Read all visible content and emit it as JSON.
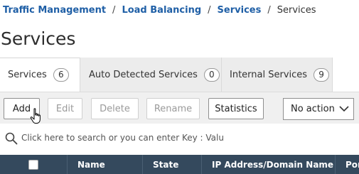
{
  "breadcrumb": {
    "items": [
      "Traffic Management",
      "Load Balancing",
      "Services"
    ],
    "current": "Services",
    "separator": "/"
  },
  "page": {
    "title": "Services"
  },
  "tabs": [
    {
      "label": "Services",
      "count": "6",
      "active": true
    },
    {
      "label": "Auto Detected Services",
      "count": "0",
      "active": false
    },
    {
      "label": "Internal Services",
      "count": "9",
      "active": false
    }
  ],
  "toolbar": {
    "add": "Add",
    "edit": "Edit",
    "delete": "Delete",
    "rename": "Rename",
    "statistics": "Statistics",
    "action_select": "No action"
  },
  "search": {
    "placeholder": "Click here to search or you can enter Key : Valu"
  },
  "table": {
    "columns": [
      "Name",
      "State",
      "IP Address/Domain Name",
      "Port"
    ]
  },
  "colors": {
    "link": "#1f5fa6",
    "header_bg": "#34495d",
    "tab_inactive_bg": "#ececec",
    "toolbar_bg": "#f0f0f0"
  },
  "icons": [
    "search-icon",
    "chevron-down-icon",
    "hand-pointer-cursor"
  ]
}
